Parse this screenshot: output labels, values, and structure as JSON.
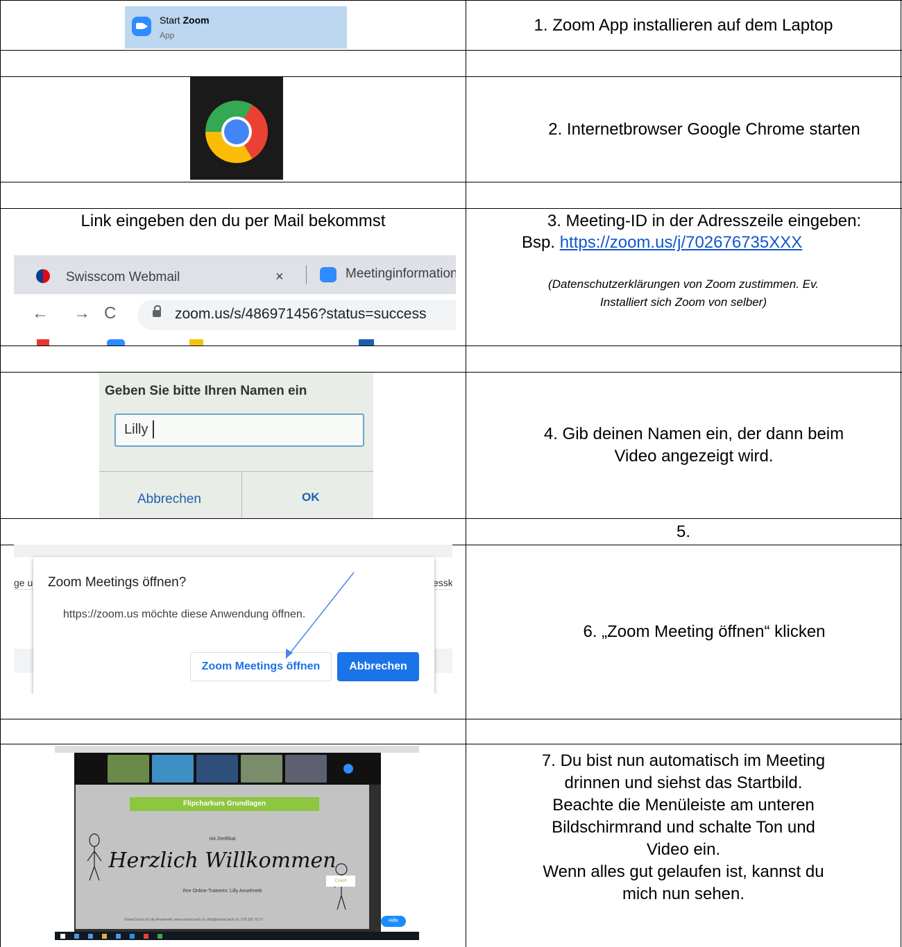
{
  "steps": {
    "step1": "1.   Zoom App installieren auf dem Laptop",
    "step2": "2.   Internetbrowser Google Chrome starten",
    "step3_heading": "3.   Meeting-ID in der Adresszeile eingeben:",
    "step3_prefix": "Bsp.",
    "step3_link": "https://zoom.us/j/702676735XXX",
    "step3_note_line1": "(Datenschutzerklärungen von Zoom zustimmen. Ev.",
    "step3_note_line2": "Installiert sich Zoom von selber)",
    "step4_line1": "4.   Gib deinen Namen ein, der dann beim",
    "step4_line2": "Video angezeigt wird.",
    "step5": "5.",
    "step6": "6.   „Zoom Meeting öffnen“ klicken",
    "step7_lines": [
      "7.   Du bist nun automatisch im Meeting",
      "drinnen und siehst das Startbild.",
      "Beachte die Menüleiste am unteren",
      "Bildschirmrand und schalte Ton und",
      "Video ein.",
      "Wenn alles gut gelaufen ist, kannst du",
      "mich nun sehen."
    ],
    "link_instruction": "Link eingeben den du per Mail bekommst"
  },
  "start_zoom": {
    "title_prefix": "Start ",
    "title_bold": "Zoom",
    "subtitle": "App",
    "icon": "zoom-video-icon"
  },
  "chrome": {
    "icon": "chrome-logo-icon"
  },
  "browser": {
    "tab1_label": "Swisscom Webmail",
    "tab_close": "×",
    "tab2_label": "Meetinginformatione",
    "back": "←",
    "forward": "→",
    "reload": "C",
    "url": "zoom.us/s/486971456?status=success"
  },
  "name_dialog": {
    "title": "Geben Sie bitte Ihren Namen ein",
    "value": "Lilly",
    "cancel": "Abbrechen",
    "ok": "OK"
  },
  "open_dialog": {
    "left_fragment": "ge u",
    "right_fragment": "essku",
    "title": "Zoom Meetings öffnen?",
    "text": "https://zoom.us möchte diese Anwendung öffnen.",
    "open_button": "Zoom Meetings öffnen",
    "cancel_button": "Abbrechen",
    "primary_color": "#1a73e8"
  },
  "zoom_meeting": {
    "banner": "Flipcharkurs Grundlagen",
    "subtitle": "mit Zertifikat",
    "welcome": "Herzlich Willkommen",
    "trainer": "Ihre Online-Trainerin: Lilly Anselmetti",
    "footer": "VisionCoach.ch Lilly Anselmetti, www.visioncoach.ch, info@visioncoach.ch, 076 330 75 27",
    "help": "Hilfe",
    "coach_logo": "Coach"
  }
}
